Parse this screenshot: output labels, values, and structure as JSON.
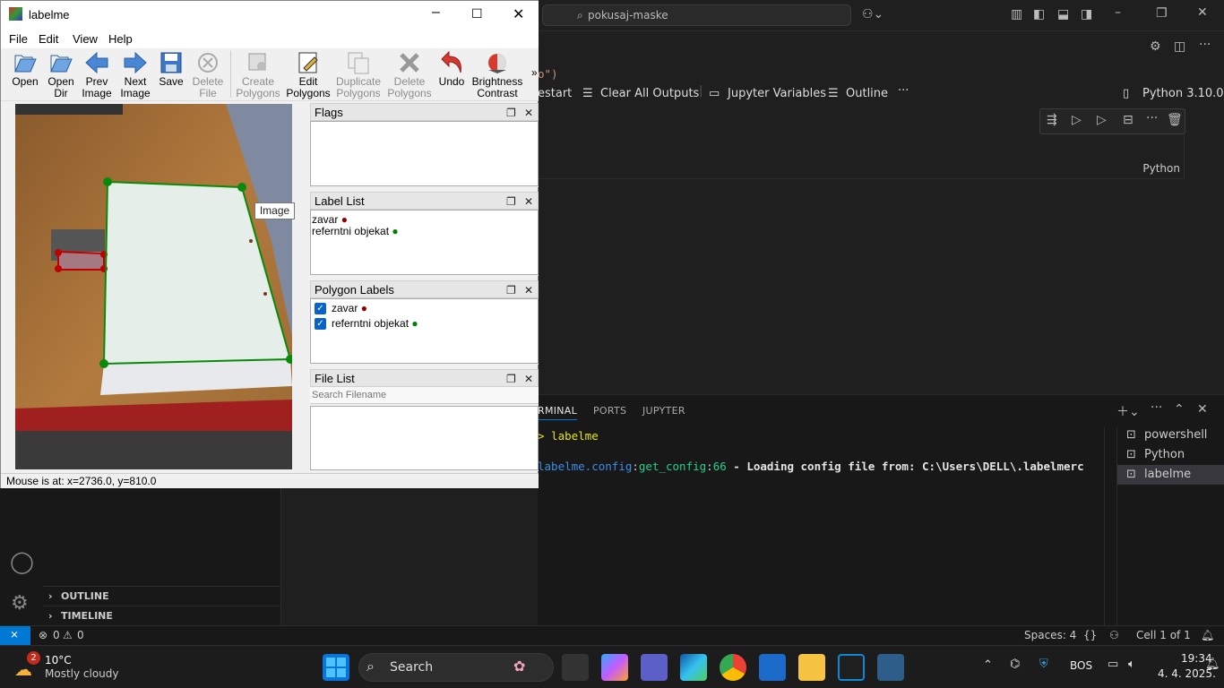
{
  "vscode": {
    "search_text": "pokusaj-maske",
    "toolbar": {
      "restart_label": "estart",
      "clear_outputs_label": "Clear All Outputs",
      "jupyter_vars_label": "Jupyter Variables",
      "outline_label": "Outline",
      "kernel_label": "Python 3.10.0"
    },
    "partial_code": "o\")",
    "cell_language": "Python",
    "panel_tabs": [
      "RMINAL",
      "PORTS",
      "JUPYTER"
    ],
    "terminal": {
      "prompt_line": "> labelme",
      "log_prefix": "labelme.config",
      "log_func": "get_config",
      "log_line": "66",
      "log_msg": " - Loading config file from: C:\\Users\\DELL\\.labelmerc"
    },
    "terminal_list": [
      "powershell",
      "Python",
      "labelme"
    ],
    "sidebar_sections": [
      "OUTLINE",
      "TIMELINE"
    ],
    "status": {
      "errors": "0",
      "warnings": "0",
      "spaces": "Spaces: 4",
      "braces": "{}",
      "cell": "Cell 1 of 1"
    }
  },
  "taskbar": {
    "weather_temp": "10°C",
    "weather_desc": "Mostly cloudy",
    "weather_badge": "2",
    "search_label": "Search",
    "language": "BOS",
    "time": "19:34",
    "date": "4. 4. 2025."
  },
  "labelme": {
    "title": "labelme",
    "menu": [
      "File",
      "Edit",
      "View",
      "Help"
    ],
    "toolbar": [
      {
        "l1": "Open",
        "l2": "",
        "icon": "open-icon",
        "disabled": false
      },
      {
        "l1": "Open",
        "l2": "Dir",
        "icon": "open-dir-icon",
        "disabled": false
      },
      {
        "l1": "Prev",
        "l2": "Image",
        "icon": "prev-image-icon",
        "disabled": false
      },
      {
        "l1": "Next",
        "l2": "Image",
        "icon": "next-image-icon",
        "disabled": false
      },
      {
        "l1": "Save",
        "l2": "",
        "icon": "save-icon",
        "disabled": false
      },
      {
        "l1": "Delete",
        "l2": "File",
        "icon": "delete-file-icon",
        "disabled": true
      },
      {
        "l1": "Create",
        "l2": "Polygons",
        "icon": "create-polygons-icon",
        "disabled": true
      },
      {
        "l1": "Edit",
        "l2": "Polygons",
        "icon": "edit-polygons-icon",
        "disabled": false
      },
      {
        "l1": "Duplicate",
        "l2": "Polygons",
        "icon": "duplicate-polygons-icon",
        "disabled": true
      },
      {
        "l1": "Delete",
        "l2": "Polygons",
        "icon": "delete-polygons-icon",
        "disabled": true
      },
      {
        "l1": "Undo",
        "l2": "",
        "icon": "undo-icon",
        "disabled": false
      },
      {
        "l1": "Brightness",
        "l2": "Contrast",
        "icon": "brightness-contrast-icon",
        "disabled": false
      }
    ],
    "more_label": "»",
    "docks": {
      "flags": "Flags",
      "label_list": "Label List",
      "polygon_labels": "Polygon Labels",
      "file_list": "File List"
    },
    "labels": [
      {
        "name": "zavar",
        "color": "#8b0000"
      },
      {
        "name": "referntni objekat",
        "color": "#008000"
      }
    ],
    "file_search_placeholder": "Search Filename",
    "tooltip": "Image",
    "status": "Mouse is at: x=2736.0, y=810.0"
  },
  "colors": {
    "accent": "#0078d4",
    "polygon_green": "#008000",
    "polygon_red": "#c00000"
  }
}
